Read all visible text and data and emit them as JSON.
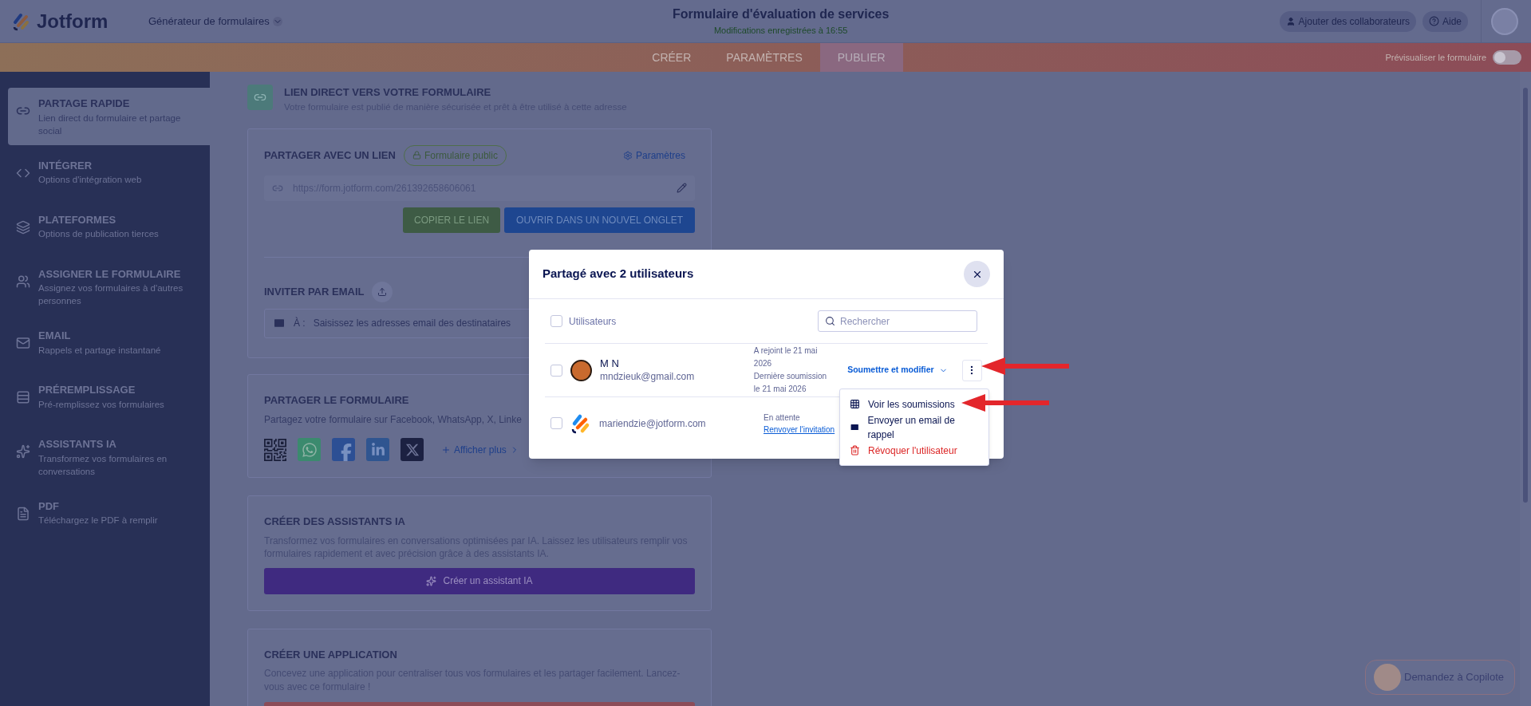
{
  "header": {
    "logo": "Jotform",
    "builder_menu": "Générateur de formulaires",
    "form_title": "Formulaire d'évaluation de services",
    "save_status": "Modifications enregistrées à 16:55",
    "collaborators_button": "Ajouter des collaborateurs",
    "help_button": "Aide"
  },
  "nav": {
    "tabs": [
      {
        "label": "CRÉER",
        "selected": false
      },
      {
        "label": "PARAMÈTRES",
        "selected": false
      },
      {
        "label": "PUBLIER",
        "selected": true
      }
    ],
    "preview": {
      "label": "Prévisualiser le formulaire",
      "on": false
    }
  },
  "sidebar": {
    "items": [
      {
        "title": "PARTAGE RAPIDE",
        "description": "Lien direct du formulaire et partage social",
        "selected": true
      },
      {
        "title": "INTÉGRER",
        "description": "Options d'intégration web",
        "selected": false
      },
      {
        "title": "PLATEFORMES",
        "description": "Options de publication tierces",
        "selected": false
      },
      {
        "title": "ASSIGNER LE FORMULAIRE",
        "description": "Assignez vos formulaires à d'autres personnes",
        "selected": false
      },
      {
        "title": "EMAIL",
        "description": "Rappels et partage instantané",
        "selected": false
      },
      {
        "title": "PRÉREMPLISSAGE",
        "description": "Pré-remplissez vos formulaires",
        "selected": false
      },
      {
        "title": "ASSISTANTS IA",
        "description": "Transformez vos formulaires en conversations",
        "selected": false
      },
      {
        "title": "PDF",
        "description": "Téléchargez le PDF à remplir",
        "selected": false
      }
    ]
  },
  "direct_link": {
    "title": "LIEN DIRECT VERS VOTRE FORMULAIRE",
    "subtitle": "Votre formulaire est publié de manière sécurisée et prêt à être utilisé à cette adresse"
  },
  "share_link": {
    "title": "PARTAGER AVEC UN LIEN",
    "badge": "Formulaire public",
    "settings": "Paramètres",
    "url": "https://form.jotform.com/261392658606061",
    "copy_button": "COPIER LE LIEN",
    "open_button": "OUVRIR DANS UN NOUVEL ONGLET"
  },
  "invite": {
    "title": "INVITER PAR EMAIL",
    "to_label": "À :",
    "placeholder": "Saisissez les adresses email des destinataires"
  },
  "share_form": {
    "title": "PARTAGER LE FORMULAIRE",
    "text": "Partagez votre formulaire sur Facebook, WhatsApp, X, Linke",
    "more": "Afficher plus"
  },
  "ai_assistants": {
    "title": "CRÉER DES ASSISTANTS IA",
    "text": "Transformez vos formulaires en conversations optimisées par IA. Laissez les utilisateurs remplir vos formulaires rapidement et avec précision grâce à des assistants IA.",
    "button": "Créer un assistant IA"
  },
  "app": {
    "title": "CRÉER UNE APPLICATION",
    "text": "Concevez une application pour centraliser tous vos formulaires et les partager facilement. Lancez-vous avec ce formulaire !"
  },
  "modal": {
    "title": "Partagé avec 2 utilisateurs",
    "select_all": {
      "label": "Utilisateurs",
      "checked": false
    },
    "search_placeholder": "Rechercher",
    "users": [
      {
        "kind": "member",
        "name": "M N",
        "email": "mndzieuk@gmail.com",
        "checked": false,
        "info": [
          "A rejoint le 21 mai 2026",
          "Dernière soumission le 21 mai 2026"
        ],
        "permission": "Soumettre et modifier"
      },
      {
        "kind": "pending",
        "email": "mariendzie@jotform.com",
        "checked": false,
        "status": "En attente",
        "resend_link": "Renvoyer l'invitation"
      }
    ],
    "menu": [
      {
        "kind": "view",
        "label": "Voir les soumissions"
      },
      {
        "kind": "remind",
        "label": "Envoyer un email de rappel"
      },
      {
        "kind": "revoke",
        "label": "Révoquer l'utilisateur"
      }
    ]
  },
  "copilot": {
    "label": "Demandez à Copilote"
  }
}
